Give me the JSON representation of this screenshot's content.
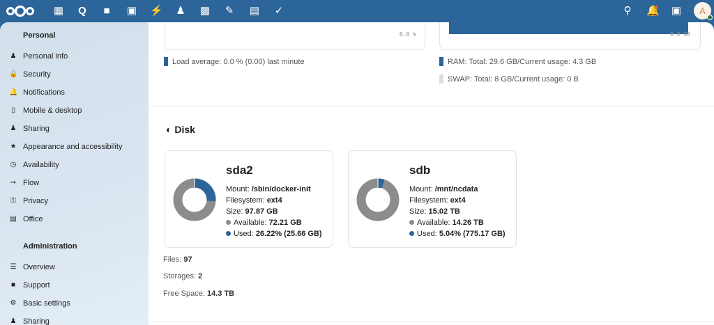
{
  "colors": {
    "brand": "#2c659a",
    "used": "#2c659a",
    "available": "#8c8c8c",
    "swap": "#dcdcdc"
  },
  "topbar": {
    "apps": [
      "dashboard-icon",
      "search-icon",
      "files-icon",
      "photos-icon",
      "activity-icon",
      "contacts-icon",
      "calendar-icon",
      "notes-icon",
      "deck-icon",
      "tasks-icon"
    ],
    "right": [
      "search-icon",
      "notifications-icon",
      "contacts-menu-icon"
    ],
    "avatar_letter": "A"
  },
  "sidebar": {
    "personal_heading": "Personal",
    "personal": [
      {
        "label": "Personal info",
        "icon": "user-icon"
      },
      {
        "label": "Security",
        "icon": "lock-icon"
      },
      {
        "label": "Notifications",
        "icon": "bell-icon"
      },
      {
        "label": "Mobile & desktop",
        "icon": "phone-icon"
      },
      {
        "label": "Sharing",
        "icon": "share-icon"
      },
      {
        "label": "Appearance and accessibility",
        "icon": "accessibility-icon"
      },
      {
        "label": "Availability",
        "icon": "clock-icon"
      },
      {
        "label": "Flow",
        "icon": "flow-icon"
      },
      {
        "label": "Privacy",
        "icon": "key-icon"
      },
      {
        "label": "Office",
        "icon": "document-icon"
      }
    ],
    "admin_heading": "Administration",
    "admin": [
      {
        "label": "Overview",
        "icon": "sliders-icon"
      },
      {
        "label": "Support",
        "icon": "chat-icon"
      },
      {
        "label": "Basic settings",
        "icon": "gear-icon"
      },
      {
        "label": "Sharing",
        "icon": "share-icon"
      }
    ]
  },
  "system": {
    "cpu_axis_label": "0.0 %",
    "mem_axis_label": "0.0 GB",
    "load": "Load average: 0.0 % (0.00) last minute",
    "ram": "RAM: Total: 29.6 GB/Current usage: 4.3 GB",
    "swap": "SWAP: Total: 8 GB/Current usage: 0 B"
  },
  "disk": {
    "title": "Disk",
    "disks": [
      {
        "name": "sda2",
        "mount_label": "Mount:",
        "mount": "/sbin/docker-init",
        "fs_label": "Filesystem:",
        "fs": "ext4",
        "size_label": "Size:",
        "size": "97.87 GB",
        "avail_label": "Available:",
        "avail": "72.21 GB",
        "used_label": "Used:",
        "used": "26.22% (25.66 GB)",
        "used_pct": 26.22
      },
      {
        "name": "sdb",
        "mount_label": "Mount:",
        "mount": "/mnt/ncdata",
        "fs_label": "Filesystem:",
        "fs": "ext4",
        "size_label": "Size:",
        "size": "15.02 TB",
        "avail_label": "Available:",
        "avail": "14.26 TB",
        "used_label": "Used:",
        "used": "5.04% (775.17 GB)",
        "used_pct": 5.04
      }
    ],
    "files_label": "Files:",
    "files": "97",
    "storages_label": "Storages:",
    "storages": "2",
    "free_label": "Free Space:",
    "free": "14.3 TB"
  }
}
